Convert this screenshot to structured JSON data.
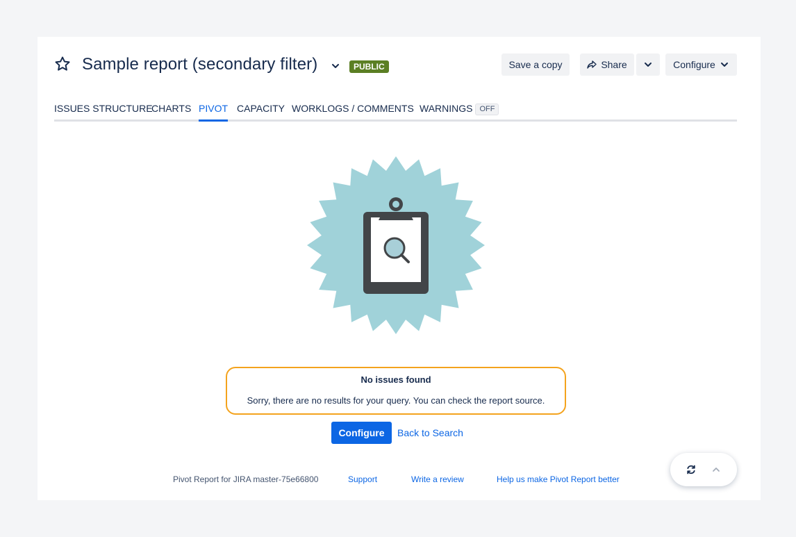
{
  "report": {
    "title": "Sample report (secondary filter)",
    "visibility_badge": "PUBLIC"
  },
  "toolbar": {
    "save_copy_label": "Save a copy",
    "share_label": "Share",
    "configure_label": "Configure"
  },
  "tabs": [
    {
      "label": "ISSUES STRUCTURE",
      "active": false
    },
    {
      "label": "CHARTS",
      "active": false
    },
    {
      "label": "PIVOT",
      "active": true
    },
    {
      "label": "CAPACITY",
      "active": false
    },
    {
      "label": "WORKLOGS / COMMENTS",
      "active": false
    },
    {
      "label": "WARNINGS",
      "active": false,
      "badge": "OFF"
    }
  ],
  "empty_state": {
    "title": "No issues found",
    "message": "Sorry, there are no results for your query. You can check the report source.",
    "primary_button": "Configure",
    "secondary_link": "Back to Search"
  },
  "footer": {
    "version": "Pivot Report for JIRA master-75e66800",
    "links": [
      "Support",
      "Write a review",
      "Help us make Pivot Report better"
    ]
  },
  "icons": {
    "star": "star-icon",
    "title_dropdown": "chevron-down-icon",
    "share": "share-icon",
    "more": "chevron-down-icon",
    "refresh": "refresh-icon",
    "scroll_up": "chevron-up-icon"
  },
  "colors": {
    "accent": "#0c66e4",
    "badge_green": "#5b7f24",
    "highlight_border": "#f4a31d",
    "illustration_bg": "#a0d2d9"
  }
}
